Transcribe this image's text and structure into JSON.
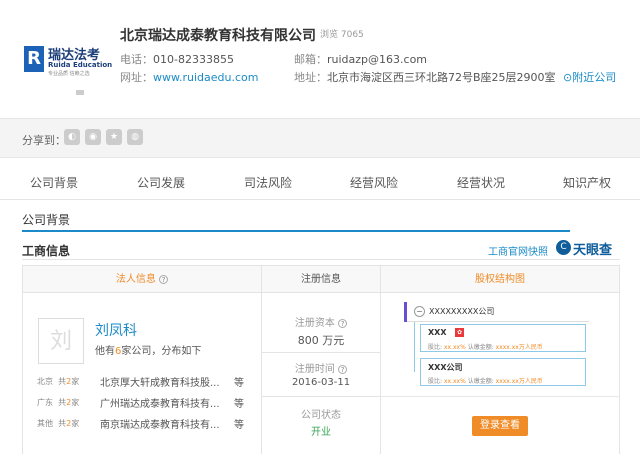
{
  "company": {
    "name": "北京瑞达成泰教育科技有限公司",
    "views": "浏览 7065",
    "phone_label": "电话：",
    "phone": "010-82333855",
    "email_label": "邮箱：",
    "email": "ruidazp@163.com",
    "website_label": "网址：",
    "website": "www.ruidaedu.com",
    "address_label": "地址：",
    "address": "北京市海淀区西三环北路72号B座25层2900室",
    "nearby": "附近公司"
  },
  "logo": {
    "letter": "R",
    "cn": "瑞达法考",
    "en": "Ruida Education",
    "sub": "专业品质 信赖之选"
  },
  "share": {
    "label": "分享到："
  },
  "nav": {
    "items": [
      "公司背景",
      "公司发展",
      "司法风险",
      "经营风险",
      "经营状况",
      "知识产权"
    ]
  },
  "section": {
    "tab": "公司背景",
    "title": "工商信息",
    "link": "工商官网快照",
    "brand": "天眼查"
  },
  "legal": {
    "header": "法人信息",
    "avatar": "刘",
    "name": "刘凤科",
    "summary_pre": "他有",
    "summary_count": "6",
    "summary_post": "家公司，分布如下",
    "rows": [
      {
        "city": "北京",
        "count_pre": "共",
        "count": "2",
        "count_post": "家",
        "company": "北京厚大轩成教育科技股...",
        "etc": "等"
      },
      {
        "city": "广东",
        "count_pre": "共",
        "count": "2",
        "count_post": "家",
        "company": "广州瑞达成泰教育科技有...",
        "etc": "等"
      },
      {
        "city": "其他",
        "count_pre": "共",
        "count": "2",
        "count_post": "家",
        "company": "南京瑞达成泰教育科技有...",
        "etc": "等"
      }
    ]
  },
  "registration": {
    "header": "注册信息",
    "capital_label": "注册资本",
    "capital": "800 万元",
    "date_label": "注册时间",
    "date": "2016-03-11",
    "status_label": "公司状态",
    "status": "开业"
  },
  "equity": {
    "header": "股权结构图",
    "root": "XXXXXXXXX公司",
    "nodes": [
      {
        "name": "XXX",
        "ratio_label": "股比:",
        "ratio": "xx.xx%",
        "amount_label": "认缴金额:",
        "amount": "xxxx.xx万人民币"
      },
      {
        "name": "XXX公司",
        "ratio_label": "股比:",
        "ratio": "xx.xx%",
        "amount_label": "认缴金额:",
        "amount": "xxxx.xx万人民币"
      }
    ],
    "button": "登录查看"
  },
  "colors": {
    "accent": "#1a8bc8",
    "orange": "#f08c28",
    "status_green": "#3aa357"
  }
}
